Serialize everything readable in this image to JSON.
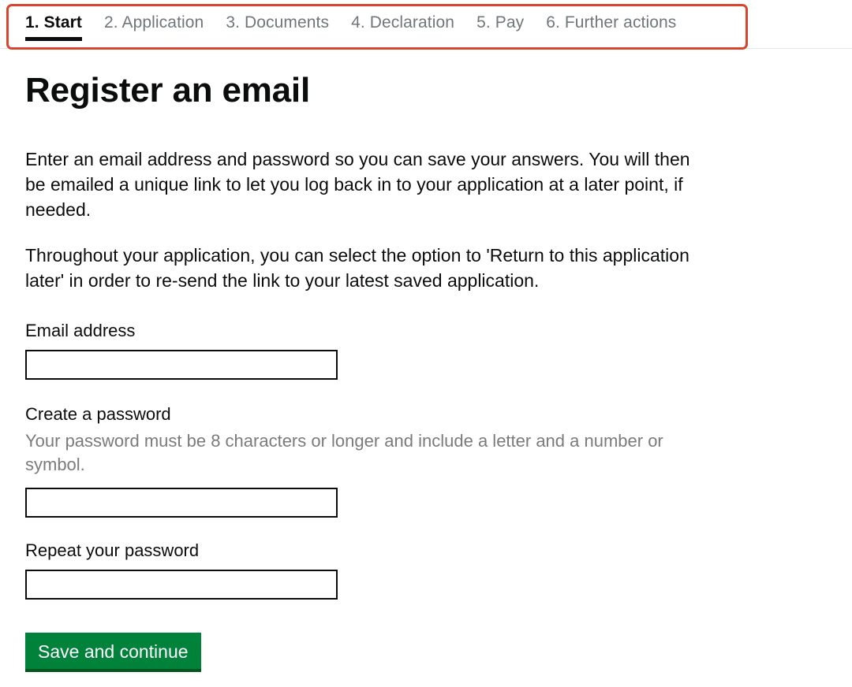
{
  "nav": {
    "highlight_color": "#d9452c",
    "items": [
      {
        "label": "1. Start",
        "active": true
      },
      {
        "label": "2. Application",
        "active": false
      },
      {
        "label": "3. Documents",
        "active": false
      },
      {
        "label": "4. Declaration",
        "active": false
      },
      {
        "label": "5. Pay",
        "active": false
      },
      {
        "label": "6. Further actions",
        "active": false
      }
    ]
  },
  "page": {
    "title": "Register an email",
    "paragraph_1": "Enter an email address and password so you can save your answers. You will then be emailed a unique link to let you log back in to your application at a later point, if needed.",
    "paragraph_2": "Throughout your application, you can select the option to 'Return to this application later' in order to re-send the link to your latest saved application."
  },
  "form": {
    "email": {
      "label": "Email address",
      "value": "",
      "placeholder": ""
    },
    "password": {
      "label": "Create a password",
      "hint": "Your password must be 8 characters or longer and include a letter and a number or symbol.",
      "value": "",
      "placeholder": ""
    },
    "repeat_password": {
      "label": "Repeat your password",
      "value": "",
      "placeholder": ""
    },
    "submit_label": "Save and continue",
    "submit_color": "#00823b"
  }
}
